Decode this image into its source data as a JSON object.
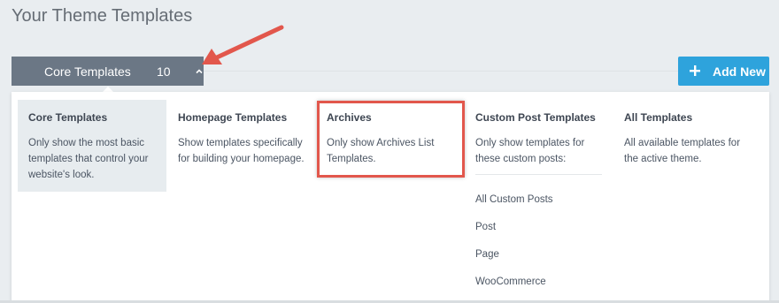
{
  "page": {
    "title": "Your Theme Templates"
  },
  "toolbar": {
    "core_label": "Core Templates",
    "core_count": "10",
    "add_new_label": "Add New"
  },
  "menu": {
    "columns": [
      {
        "title": "Core Templates",
        "description": "Only show the most basic templates that control your website's look."
      },
      {
        "title": "Homepage Templates",
        "description": "Show templates specifically for building your homepage."
      },
      {
        "title": "Archives",
        "description": "Only show Archives List Templates."
      },
      {
        "title": "Custom Post Templates",
        "description": "Only show templates for these custom posts:"
      },
      {
        "title": "All Templates",
        "description": "All available templates for the active theme."
      }
    ],
    "post_types": [
      "All Custom Posts",
      "Post",
      "Page",
      "WooCommerce"
    ]
  },
  "colors": {
    "dropdown_bg": "#6b7785",
    "accent": "#2ea3dc",
    "highlight": "#e2574c",
    "active_column_bg": "#e7ecef"
  },
  "icons": {
    "dropdown_toggle": "chevron-up-icon",
    "add_new": "plus-icon",
    "annotation": "red-arrow-icon"
  }
}
